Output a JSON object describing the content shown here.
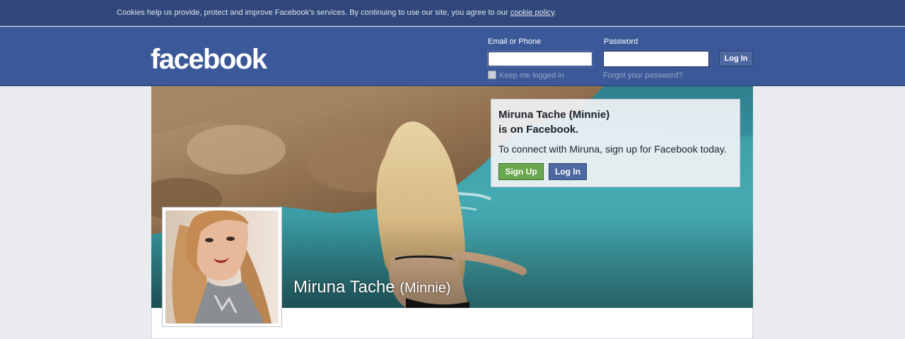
{
  "cookie_bar": {
    "text": "Cookies help us provide, protect and improve Facebook's services. By continuing to use our site, you agree to our ",
    "link": "cookie policy",
    "suffix": "."
  },
  "header": {
    "logo": "facebook",
    "email_label": "Email or Phone",
    "email_value": "",
    "password_label": "Password",
    "password_value": "",
    "login_button": "Log In",
    "keep_logged_in": "Keep me logged in",
    "forgot_password": "Forgot your password?"
  },
  "profile": {
    "name": "Miruna Tache",
    "nickname": "(Minnie)"
  },
  "connect_box": {
    "title_line1": "Miruna Tache (Minnie)",
    "title_line2": "is on Facebook.",
    "subtitle": "To connect with Miruna, sign up for Facebook today.",
    "signup_button": "Sign Up",
    "login_button": "Log In"
  },
  "colors": {
    "brand": "#3b5998",
    "cookie_bar": "#2f477a",
    "signup_green": "#69a74e",
    "page_bg": "#e9ebee"
  }
}
